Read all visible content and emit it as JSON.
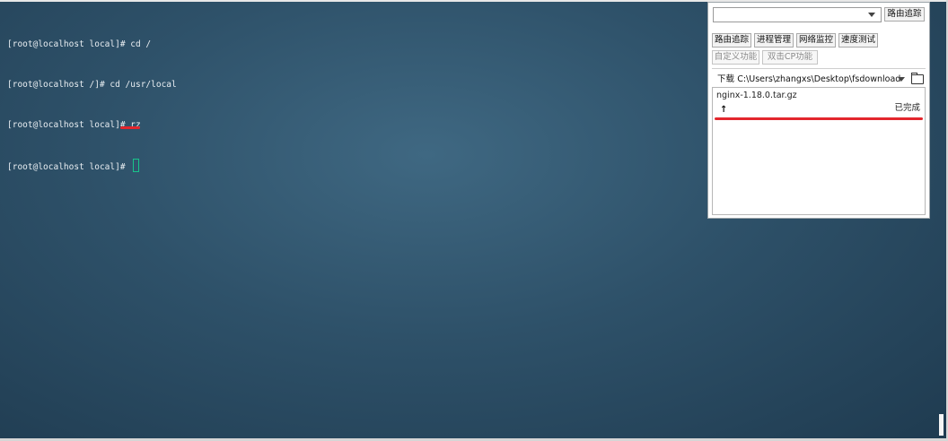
{
  "terminal": {
    "lines": [
      "[root@localhost local]# cd /",
      "[root@localhost /]# cd /usr/local",
      "[root@localhost local]# rz",
      "[root@localhost local]# "
    ]
  },
  "tool_panel": {
    "host_select": {
      "value": ""
    },
    "route_trace_button": "路由追踪",
    "tabs": [
      "路由追踪",
      "进程管理",
      "网络监控",
      "速度测试"
    ],
    "actions": [
      "自定义功能",
      "双击CP功能"
    ],
    "download": {
      "label": "下载",
      "path": "C:\\Users\\zhangxs\\Desktop\\fsdownload",
      "files": [
        {
          "name": "nginx-1.18.0.tar.gz",
          "direction": "↑",
          "status": "已完成"
        }
      ]
    }
  },
  "colors": {
    "background": "#2e5169",
    "terminal_text": "#e9eef2",
    "cursor": "#18c48a",
    "highlight_mark": "#e3262d"
  }
}
